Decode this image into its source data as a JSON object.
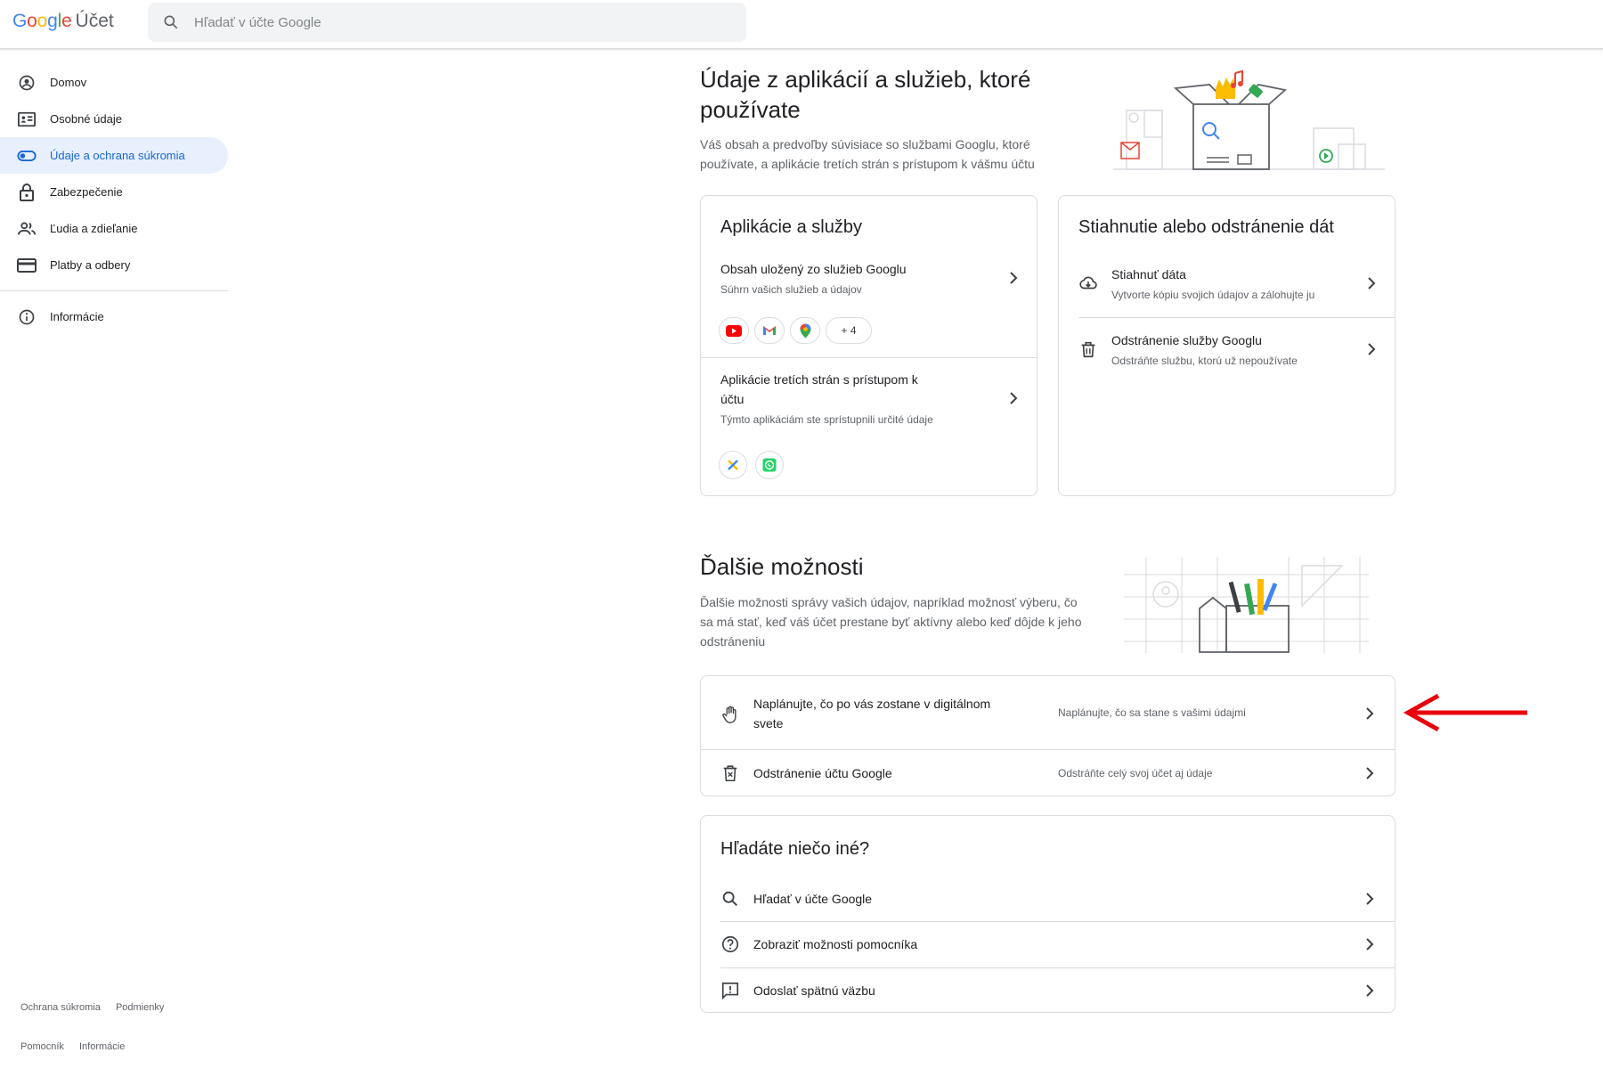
{
  "header": {
    "brand_google": "Google",
    "brand_account": "Účet",
    "search_placeholder": "Hľadať v účte Google"
  },
  "sidebar": {
    "items": [
      {
        "label": "Domov",
        "icon": "account-circle-icon"
      },
      {
        "label": "Osobné údaje",
        "icon": "id-card-icon"
      },
      {
        "label": "Údaje a ochrana súkromia",
        "icon": "toggle-icon",
        "active": true
      },
      {
        "label": "Zabezpečenie",
        "icon": "lock-icon"
      },
      {
        "label": "Ľudia a zdieľanie",
        "icon": "people-icon"
      },
      {
        "label": "Platby a odbery",
        "icon": "credit-card-icon"
      }
    ],
    "info": {
      "label": "Informácie",
      "icon": "info-icon"
    },
    "footer": {
      "privacy": "Ochrana súkromia",
      "terms": "Podmienky",
      "help": "Pomocník",
      "about": "Informácie"
    }
  },
  "apps_section": {
    "title": "Údaje z aplikácií a služieb, ktoré používate",
    "description": "Váš obsah a predvoľby súvisiace so službami Googlu, ktoré používate, a aplikácie tretích strán s prístupom k vášmu účtu"
  },
  "apps_card": {
    "title": "Aplikácie a služby",
    "rows": [
      {
        "title": "Obsah uložený zo služieb Googlu",
        "subtitle": "Súhrn vašich služieb a údajov",
        "more_count": "+ 4"
      },
      {
        "title": "Aplikácie tretích strán s prístupom k účtu",
        "subtitle": "Týmto aplikáciám ste sprístupnili určité údaje"
      }
    ]
  },
  "download_card": {
    "title": "Stiahnutie alebo odstránenie dát",
    "rows": [
      {
        "title": "Stiahnuť dáta",
        "subtitle": "Vytvorte kópiu svojich údajov a zálohujte ju",
        "icon": "cloud-download-icon"
      },
      {
        "title": "Odstránenie služby Googlu",
        "subtitle": "Odstráňte službu, ktorú už nepoužívate",
        "icon": "trash-icon"
      }
    ]
  },
  "more_section": {
    "title": "Ďalšie možnosti",
    "description": "Ďalšie možnosti správy vašich údajov, napríklad možnosť výberu, čo sa má stať, keď váš účet prestane byť aktívny alebo keď dôjde k jeho odstráneniu"
  },
  "more_card": {
    "rows": [
      {
        "title": "Naplánujte, čo po vás zostane v digitálnom svete",
        "subtitle": "Naplánujte, čo sa stane s vašimi údajmi",
        "icon": "hand-icon"
      },
      {
        "title": "Odstránenie účtu Google",
        "subtitle": "Odstráňte celý svoj účet aj údaje",
        "icon": "delete-account-icon"
      }
    ]
  },
  "help_card": {
    "title": "Hľadáte niečo iné?",
    "rows": [
      {
        "title": "Hľadať v účte Google",
        "icon": "search-icon"
      },
      {
        "title": "Zobraziť možnosti pomocníka",
        "icon": "help-icon"
      },
      {
        "title": "Odoslať spätnú väzbu",
        "icon": "feedback-icon"
      }
    ]
  },
  "colors": {
    "accent": "#1967d2",
    "active_bg": "#e8f0fe",
    "annotation_arrow": "#e8000b"
  }
}
